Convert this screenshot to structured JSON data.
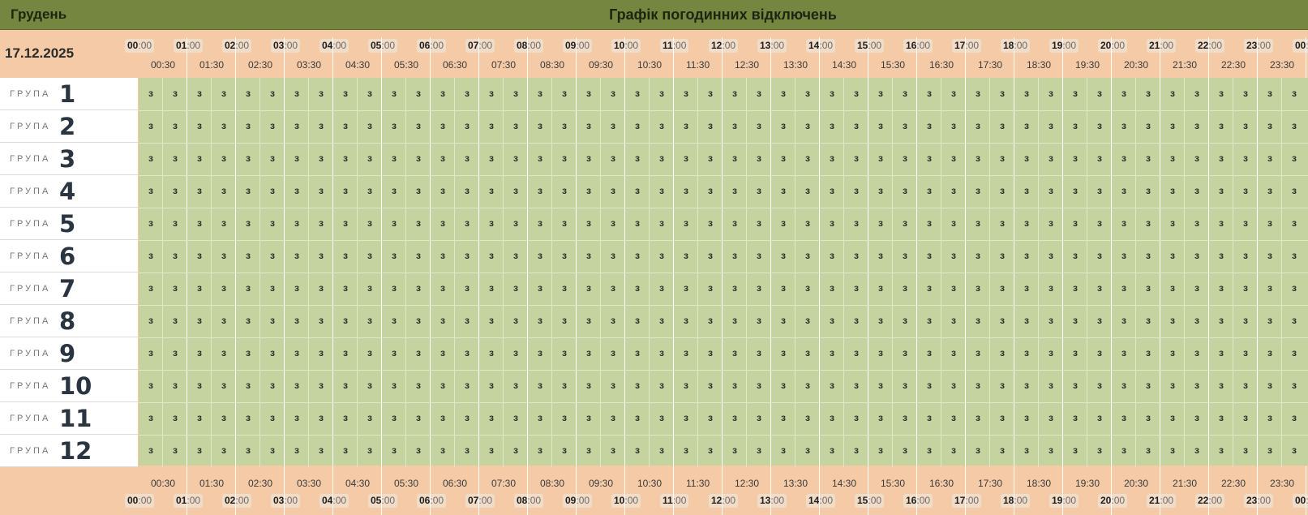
{
  "header": {
    "month": "Грудень",
    "title": "Графік погодинних відключень",
    "date": "17.12.2025"
  },
  "hours": [
    "00",
    "01",
    "02",
    "03",
    "04",
    "05",
    "06",
    "07",
    "08",
    "09",
    "10",
    "11",
    "12",
    "13",
    "14",
    "15",
    "16",
    "17",
    "18",
    "19",
    "20",
    "21",
    "22",
    "23",
    "00"
  ],
  "hour_suffix": ":00",
  "half_hours": [
    "00:30",
    "01:30",
    "02:30",
    "03:30",
    "04:30",
    "05:30",
    "06:30",
    "07:30",
    "08:30",
    "09:30",
    "10:30",
    "11:30",
    "12:30",
    "13:30",
    "14:30",
    "15:30",
    "16:30",
    "17:30",
    "18:30",
    "19:30",
    "20:30",
    "21:30",
    "22:30",
    "23:30"
  ],
  "groups": {
    "word": "ГРУПА",
    "numbers": [
      "1",
      "2",
      "3",
      "4",
      "5",
      "6",
      "7",
      "8",
      "9",
      "10",
      "11",
      "12"
    ]
  },
  "cell_value": "з",
  "cells_per_row": 48,
  "colors": {
    "header_bar": "#758640",
    "background": "#f5cba7",
    "grid_power_on": "#c5d3a0"
  }
}
